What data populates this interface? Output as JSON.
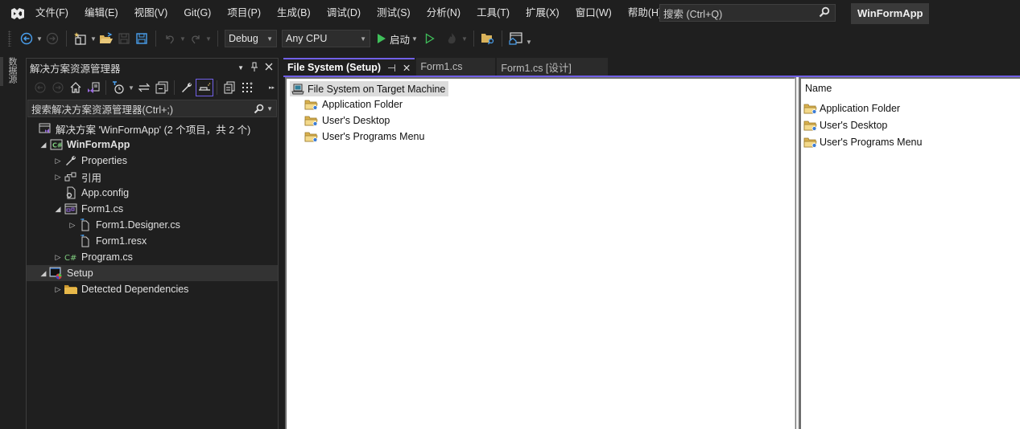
{
  "menubar": {
    "items": [
      "文件(F)",
      "编辑(E)",
      "视图(V)",
      "Git(G)",
      "项目(P)",
      "生成(B)",
      "调试(D)",
      "测试(S)",
      "分析(N)",
      "工具(T)",
      "扩展(X)",
      "窗口(W)",
      "帮助(H)"
    ],
    "search_placeholder": "搜索 (Ctrl+Q)",
    "app_title": "WinFormApp"
  },
  "toolbar": {
    "configuration": "Debug",
    "platform": "Any CPU",
    "start_label": "启动"
  },
  "side_strip": {
    "tab_label": "数据源"
  },
  "solution_explorer": {
    "title": "解决方案资源管理器",
    "search_placeholder": "搜索解决方案资源管理器(Ctrl+;)",
    "tree": [
      {
        "label": "解决方案 'WinFormApp' (2 个项目，共 2 个)",
        "icon": "solution-icon",
        "depth": 0,
        "expander": "none"
      },
      {
        "label": "WinFormApp",
        "icon": "csharp-project-icon",
        "depth": 0,
        "expander": "expanded",
        "bold": true
      },
      {
        "label": "Properties",
        "icon": "wrench-icon",
        "depth": 1,
        "expander": "collapsed"
      },
      {
        "label": "引用",
        "icon": "references-icon",
        "depth": 1,
        "expander": "collapsed"
      },
      {
        "label": "App.config",
        "icon": "config-file-icon",
        "depth": 1,
        "expander": "none"
      },
      {
        "label": "Form1.cs",
        "icon": "form-icon",
        "depth": 1,
        "expander": "expanded"
      },
      {
        "label": "Form1.Designer.cs",
        "icon": "file-icon",
        "depth": 2,
        "expander": "collapsed"
      },
      {
        "label": "Form1.resx",
        "icon": "file-icon",
        "depth": 2,
        "expander": "none"
      },
      {
        "label": "Program.cs",
        "icon": "csharp-file-icon",
        "depth": 1,
        "expander": "collapsed"
      },
      {
        "label": "Setup",
        "icon": "setup-project-icon",
        "depth": 0,
        "expander": "expanded",
        "selected": true
      },
      {
        "label": "Detected Dependencies",
        "icon": "folder-icon",
        "depth": 1,
        "expander": "collapsed"
      }
    ]
  },
  "document_tabs": [
    {
      "label": "File System (Setup)",
      "active": true
    },
    {
      "label": "Form1.cs",
      "active": false
    },
    {
      "label": "Form1.cs [设计]",
      "active": false
    }
  ],
  "file_system": {
    "root_label": "File System on Target Machine",
    "folders": [
      "Application Folder",
      "User's Desktop",
      "User's Programs Menu"
    ],
    "list_column_header": "Name",
    "list_items": [
      "Application Folder",
      "User's Desktop",
      "User's Programs Menu"
    ]
  },
  "colors": {
    "accent": "#7160e8",
    "background": "#1f1f1f"
  }
}
